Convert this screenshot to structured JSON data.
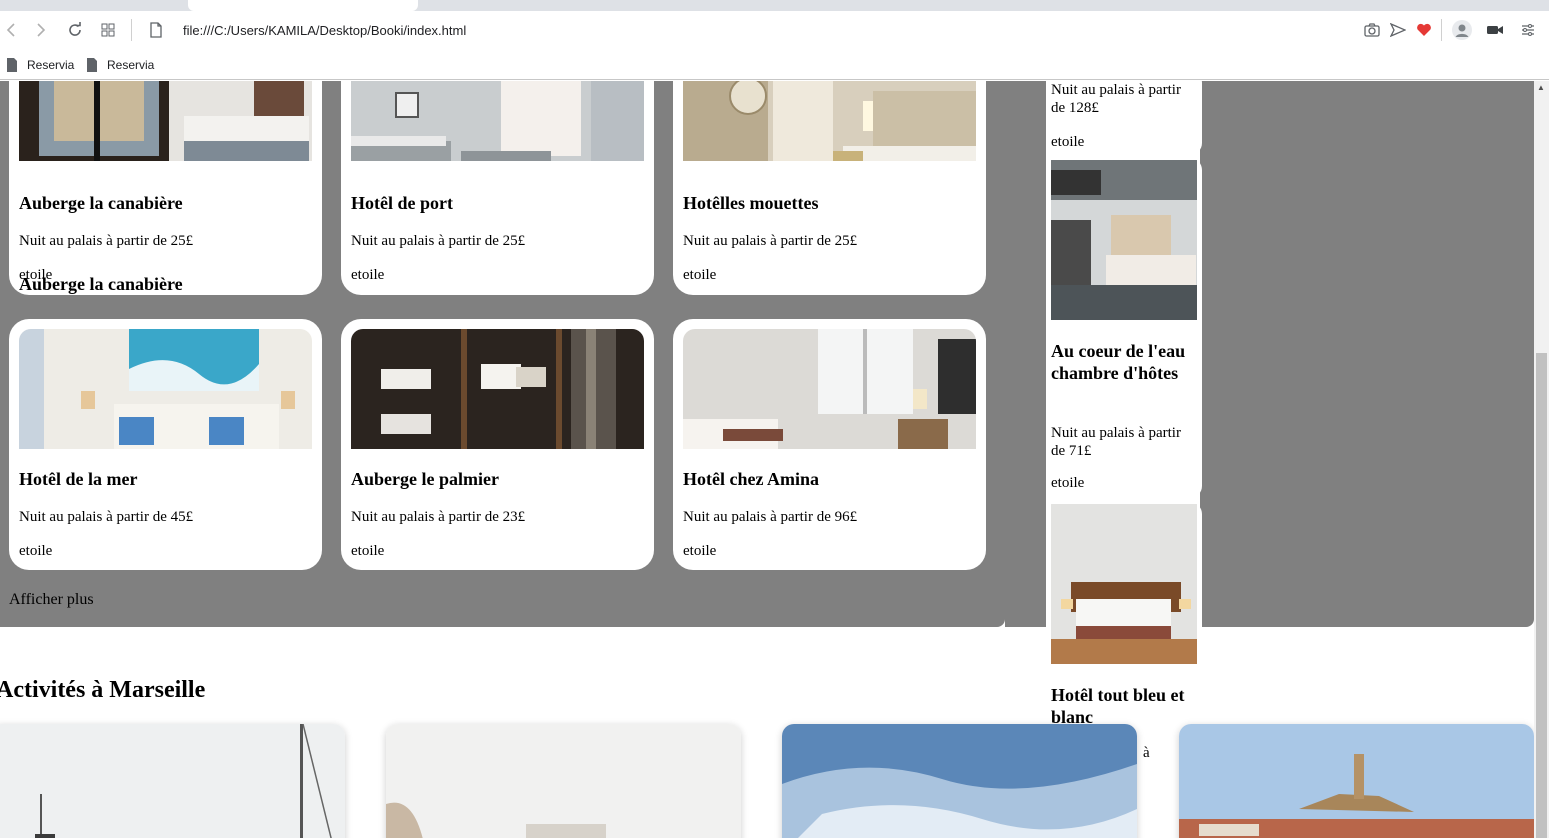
{
  "browser": {
    "url": "file:///C:/Users/KAMILA/Desktop/Booki/index.html",
    "bookmarks": [
      {
        "label": "Reservia"
      },
      {
        "label": "Reservia"
      }
    ]
  },
  "hotels": [
    {
      "name": "Auberge la canabière",
      "price_text": "Nuit au palais à partir de 25£",
      "rating_text": "etoile"
    },
    {
      "name": "Hotêl de port",
      "price_text": "Nuit au palais à partir de 25£",
      "rating_text": "etoile"
    },
    {
      "name": "Hotêlles mouettes",
      "price_text": "Nuit au palais à partir de 25£",
      "rating_text": "etoile"
    },
    {
      "name": "Hotêl de la mer",
      "price_text": "Nuit au palais à partir de 45£",
      "rating_text": "etoile"
    },
    {
      "name": "Auberge le palmier",
      "price_text": "Nuit au palais à partir de 23£",
      "rating_text": "etoile"
    },
    {
      "name": "Hotêl chez Amina",
      "price_text": "Nuit au palais à partir de 96£",
      "rating_text": "etoile"
    }
  ],
  "popular": [
    {
      "price_text": "Nuit au palais à partir de 128£",
      "rating_text": "etoile"
    },
    {
      "name": "Au coeur de l'eau chambre d'hôtes",
      "price_text": "Nuit au palais à partir de 71£",
      "rating_text": "etoile"
    },
    {
      "name": "Hotêl tout bleu et blanc",
      "price_text": "à"
    }
  ],
  "show_more": "Afficher plus",
  "activities_title": "Activités à Marseille",
  "colors": {
    "panel_grey": "#808080",
    "favorite_heart": "#e53935"
  }
}
